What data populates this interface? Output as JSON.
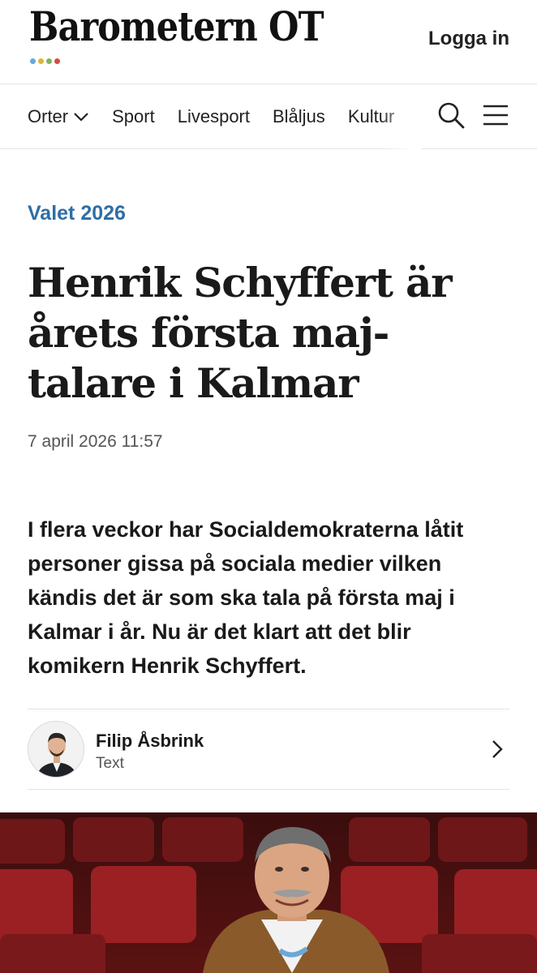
{
  "header": {
    "logo_text": "Barometern OT",
    "login_label": "Logga in",
    "logo_dot_colors": [
      "#6aa8d8",
      "#e4b33a",
      "#7bb661",
      "#d84b3c"
    ]
  },
  "nav": {
    "items": [
      {
        "label": "Orter",
        "has_dropdown": true
      },
      {
        "label": "Sport"
      },
      {
        "label": "Livesport"
      },
      {
        "label": "Blåljus"
      },
      {
        "label": "Kultur"
      }
    ],
    "icons": [
      "search-icon",
      "menu-icon"
    ]
  },
  "article": {
    "kicker": "Valet 2026",
    "headline": "Henrik Schyffert är årets första maj-talare i Kalmar",
    "date": "7 april 2026 11:57",
    "lead": "I flera veckor har Socialdemokraterna låtit personer gissa på sociala medier vilken kändis det är som ska tala på första maj i Kalmar i år. Nu är det klart att det blir komikern Henrik Schyffert."
  },
  "byline": {
    "author_name": "Filip Åsbrink",
    "author_role": "Text"
  },
  "colors": {
    "kicker": "#2e6ea6",
    "divider": "#e3e3e3"
  }
}
